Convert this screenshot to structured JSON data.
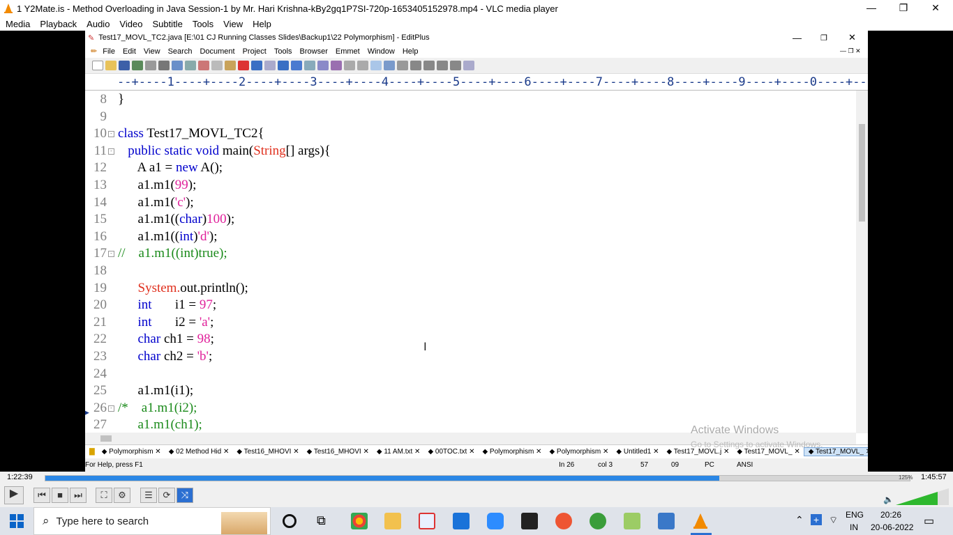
{
  "vlc": {
    "title": "1 Y2Mate.is - Method Overloading in Java  Session-1  by Mr. Hari Krishna-kBy2gq1P7SI-720p-1653405152978.mp4 - VLC media player",
    "menu": [
      "Media",
      "Playback",
      "Audio",
      "Video",
      "Subtitle",
      "Tools",
      "View",
      "Help"
    ],
    "time_elapsed": "1:22:39",
    "time_total": "1:45:57",
    "progress": 0.78,
    "volume_label": "125%"
  },
  "editplus": {
    "title": "Test17_MOVL_TC2.java [E:\\01 CJ Running Classes Slides\\Backup1\\22 Polymorphism] - EditPlus",
    "menu": [
      "File",
      "Edit",
      "View",
      "Search",
      "Document",
      "Project",
      "Tools",
      "Browser",
      "Emmet",
      "Window",
      "Help"
    ],
    "ruler": "--+----1----+----2----+----3----+----4----+----5----+----6----+----7----+----8----+----9----+----0----+----1----+----2-",
    "code_lines": [
      {
        "num": "8",
        "fold": "",
        "segments": [
          {
            "t": "}",
            "c": ""
          }
        ]
      },
      {
        "num": "9",
        "fold": "",
        "segments": []
      },
      {
        "num": "10",
        "fold": "⊟",
        "segments": [
          {
            "t": "class ",
            "c": "kw"
          },
          {
            "t": "Test17_MOVL_TC2{",
            "c": ""
          }
        ]
      },
      {
        "num": "11",
        "fold": "⊟",
        "segments": [
          {
            "t": "   public static void ",
            "c": "kw"
          },
          {
            "t": "main(",
            "c": ""
          },
          {
            "t": "String",
            "c": "red"
          },
          {
            "t": "[] args){",
            "c": ""
          }
        ]
      },
      {
        "num": "12",
        "fold": "",
        "segments": [
          {
            "t": "      A a1 = ",
            "c": ""
          },
          {
            "t": "new ",
            "c": "kw"
          },
          {
            "t": "A();",
            "c": ""
          }
        ]
      },
      {
        "num": "13",
        "fold": "",
        "segments": [
          {
            "t": "      a1.m1(",
            "c": ""
          },
          {
            "t": "99",
            "c": "str"
          },
          {
            "t": ");",
            "c": ""
          }
        ]
      },
      {
        "num": "14",
        "fold": "",
        "segments": [
          {
            "t": "      a1.m1(",
            "c": ""
          },
          {
            "t": "'c'",
            "c": "str"
          },
          {
            "t": ");",
            "c": ""
          }
        ]
      },
      {
        "num": "15",
        "fold": "",
        "segments": [
          {
            "t": "      a1.m1((",
            "c": ""
          },
          {
            "t": "char",
            "c": "kw"
          },
          {
            "t": ")",
            "c": ""
          },
          {
            "t": "100",
            "c": "str"
          },
          {
            "t": ");",
            "c": ""
          }
        ]
      },
      {
        "num": "16",
        "fold": "",
        "segments": [
          {
            "t": "      a1.m1((",
            "c": ""
          },
          {
            "t": "int",
            "c": "kw"
          },
          {
            "t": ")",
            "c": ""
          },
          {
            "t": "'d'",
            "c": "str"
          },
          {
            "t": ");",
            "c": ""
          }
        ]
      },
      {
        "num": "17",
        "fold": "⊟",
        "segments": [
          {
            "t": "//    a1.m1((int)true);",
            "c": "cmt"
          }
        ]
      },
      {
        "num": "18",
        "fold": "",
        "segments": []
      },
      {
        "num": "19",
        "fold": "",
        "segments": [
          {
            "t": "      ",
            "c": ""
          },
          {
            "t": "System.",
            "c": "red"
          },
          {
            "t": "out.println();",
            "c": ""
          }
        ]
      },
      {
        "num": "20",
        "fold": "",
        "segments": [
          {
            "t": "      ",
            "c": ""
          },
          {
            "t": "int",
            "c": "kw"
          },
          {
            "t": "       i1 = ",
            "c": ""
          },
          {
            "t": "97",
            "c": "str"
          },
          {
            "t": ";",
            "c": ""
          }
        ]
      },
      {
        "num": "21",
        "fold": "",
        "segments": [
          {
            "t": "      ",
            "c": ""
          },
          {
            "t": "int",
            "c": "kw"
          },
          {
            "t": "       i2 = ",
            "c": ""
          },
          {
            "t": "'a'",
            "c": "str"
          },
          {
            "t": ";",
            "c": ""
          }
        ]
      },
      {
        "num": "22",
        "fold": "",
        "segments": [
          {
            "t": "      ",
            "c": ""
          },
          {
            "t": "char ",
            "c": "kw"
          },
          {
            "t": "ch1 = ",
            "c": ""
          },
          {
            "t": "98",
            "c": "str"
          },
          {
            "t": ";",
            "c": ""
          }
        ]
      },
      {
        "num": "23",
        "fold": "",
        "segments": [
          {
            "t": "      ",
            "c": ""
          },
          {
            "t": "char ",
            "c": "kw"
          },
          {
            "t": "ch2 = ",
            "c": ""
          },
          {
            "t": "'b'",
            "c": "str"
          },
          {
            "t": ";",
            "c": ""
          }
        ]
      },
      {
        "num": "24",
        "fold": "",
        "segments": []
      },
      {
        "num": "25",
        "fold": "",
        "segments": [
          {
            "t": "      a1.m1(i1);",
            "c": ""
          }
        ]
      },
      {
        "num": "26",
        "fold": "⊟",
        "segments": [
          {
            "t": "/*    a1.m1(i2);",
            "c": "cmt"
          }
        ]
      },
      {
        "num": "27",
        "fold": "",
        "segments": [
          {
            "t": "      a1.m1(ch1);",
            "c": "cmt"
          }
        ]
      }
    ],
    "tabs": [
      "Polymorphism",
      "02 Method Hid",
      "Test16_MHOVI",
      "Test16_MHOVI",
      "11 AM.txt",
      "00TOC.txt",
      "Polymorphism",
      "Polymorphism",
      "Untitled1",
      "Test17_MOVL.j",
      "Test17_MOVL_",
      "Test17_MOVL_"
    ],
    "active_tab_index": 11,
    "status": {
      "help": "For Help, press F1",
      "line": "In 26",
      "col": "col 3",
      "c1": "57",
      "c2": "09",
      "mode": "PC",
      "enc": "ANSI"
    }
  },
  "watermark": {
    "line1": "Activate Windows",
    "line2": "Go to Settings to activate Windows."
  },
  "taskbar": {
    "search_placeholder": "Type here to search",
    "lang": "ENG",
    "region": "IN",
    "time": "20:26",
    "date": "20-06-2022"
  },
  "colors": {
    "accent": "#2b87e5",
    "keyword": "#0000cc",
    "string": "#e0209a",
    "comment": "#1a8a1a",
    "type": "#e0301e"
  }
}
